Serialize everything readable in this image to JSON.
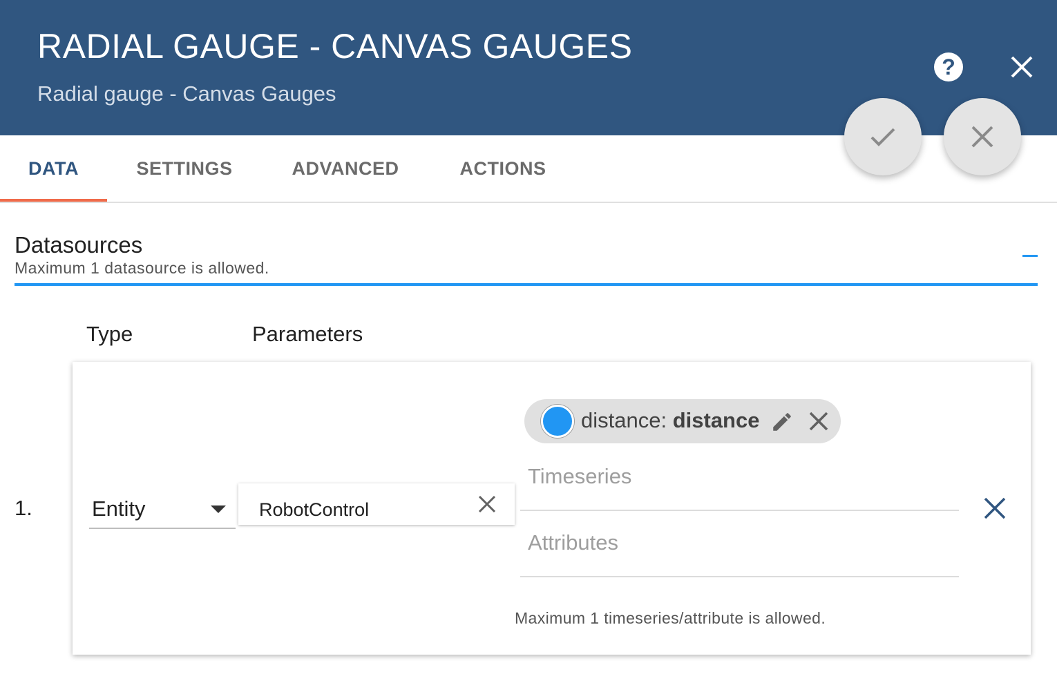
{
  "header": {
    "title": "RADIAL GAUGE - CANVAS GAUGES",
    "subtitle": "Radial gauge - Canvas Gauges",
    "help_icon": "help-circle-icon",
    "help_glyph": "?",
    "close_icon": "close-icon",
    "color": "#305680"
  },
  "fabs": {
    "apply_icon": "check-icon",
    "cancel_icon": "close-icon"
  },
  "tabs": [
    {
      "label": "DATA",
      "active": true
    },
    {
      "label": "SETTINGS",
      "active": false
    },
    {
      "label": "ADVANCED",
      "active": false
    },
    {
      "label": "ACTIONS",
      "active": false
    }
  ],
  "datasources": {
    "title": "Datasources",
    "hint": "Maximum 1 datasource is allowed.",
    "collapse_icon": "minus-icon",
    "columns": {
      "type": "Type",
      "parameters": "Parameters"
    },
    "rows": [
      {
        "index": "1.",
        "type": "Entity",
        "entity": "RobotControl",
        "keys": [
          {
            "label": "distance",
            "name": "distance",
            "color": "#2196f3",
            "separator": ": "
          }
        ],
        "timeseries_placeholder": "Timeseries",
        "attributes_placeholder": "Attributes",
        "keys_hint": "Maximum 1 timeseries/attribute is allowed."
      }
    ]
  },
  "colors": {
    "accent": "#2196f3",
    "tab_indicator": "#f06b4a"
  }
}
